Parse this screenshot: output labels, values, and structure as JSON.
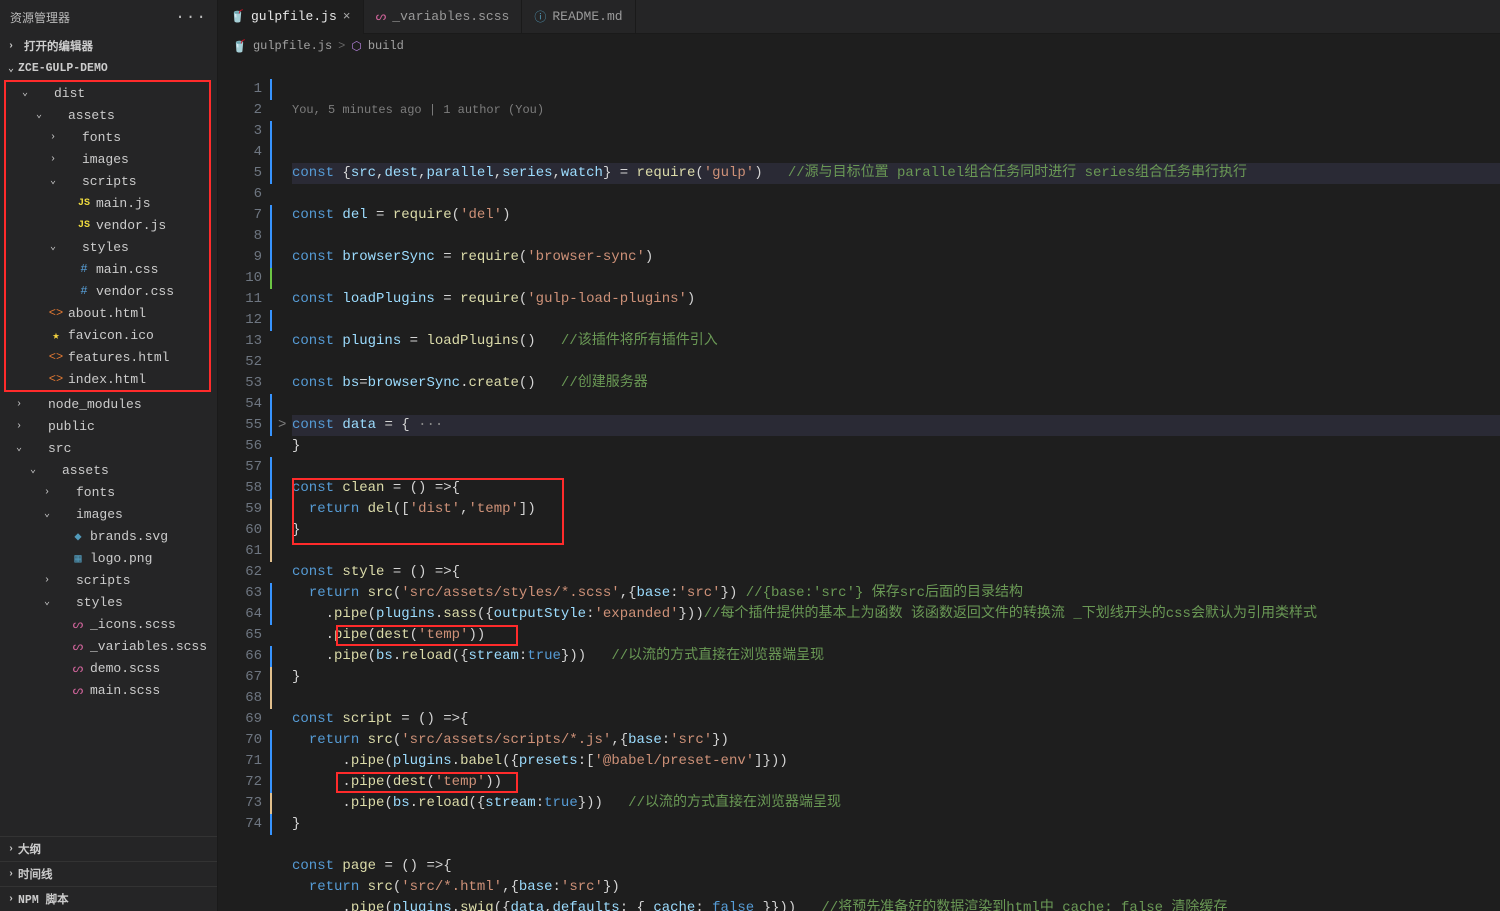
{
  "sidebar": {
    "title": "资源管理器",
    "sections": {
      "open_editors": "打开的编辑器",
      "project": "ZCE-GULP-DEMO",
      "outline": "大纲",
      "timeline": "时间线",
      "npm": "NPM 脚本"
    },
    "tree_top": [
      {
        "d": 1,
        "chev": "v",
        "ico": "",
        "cls": "",
        "name": "dist"
      },
      {
        "d": 2,
        "chev": "v",
        "ico": "",
        "cls": "",
        "name": "assets"
      },
      {
        "d": 3,
        "chev": ">",
        "ico": "",
        "cls": "",
        "name": "fonts"
      },
      {
        "d": 3,
        "chev": ">",
        "ico": "",
        "cls": "",
        "name": "images"
      },
      {
        "d": 3,
        "chev": "v",
        "ico": "",
        "cls": "",
        "name": "scripts"
      },
      {
        "d": 4,
        "chev": "",
        "ico": "JS",
        "cls": "js",
        "name": "main.js"
      },
      {
        "d": 4,
        "chev": "",
        "ico": "JS",
        "cls": "js",
        "name": "vendor.js"
      },
      {
        "d": 3,
        "chev": "v",
        "ico": "",
        "cls": "",
        "name": "styles"
      },
      {
        "d": 4,
        "chev": "",
        "ico": "#",
        "cls": "css",
        "name": "main.css"
      },
      {
        "d": 4,
        "chev": "",
        "ico": "#",
        "cls": "css",
        "name": "vendor.css"
      },
      {
        "d": 2,
        "chev": "",
        "ico": "<>",
        "cls": "html",
        "name": "about.html"
      },
      {
        "d": 2,
        "chev": "",
        "ico": "★",
        "cls": "star",
        "name": "favicon.ico"
      },
      {
        "d": 2,
        "chev": "",
        "ico": "<>",
        "cls": "html",
        "name": "features.html"
      },
      {
        "d": 2,
        "chev": "",
        "ico": "<>",
        "cls": "html",
        "name": "index.html"
      }
    ],
    "tree_bottom": [
      {
        "d": 1,
        "chev": ">",
        "ico": "",
        "cls": "",
        "name": "node_modules"
      },
      {
        "d": 1,
        "chev": ">",
        "ico": "",
        "cls": "",
        "name": "public"
      },
      {
        "d": 1,
        "chev": "v",
        "ico": "",
        "cls": "",
        "name": "src"
      },
      {
        "d": 2,
        "chev": "v",
        "ico": "",
        "cls": "",
        "name": "assets"
      },
      {
        "d": 3,
        "chev": ">",
        "ico": "",
        "cls": "",
        "name": "fonts"
      },
      {
        "d": 3,
        "chev": "v",
        "ico": "",
        "cls": "",
        "name": "images"
      },
      {
        "d": 4,
        "chev": "",
        "ico": "◆",
        "cls": "img",
        "name": "brands.svg"
      },
      {
        "d": 4,
        "chev": "",
        "ico": "▦",
        "cls": "img",
        "name": "logo.png"
      },
      {
        "d": 3,
        "chev": ">",
        "ico": "",
        "cls": "",
        "name": "scripts"
      },
      {
        "d": 3,
        "chev": "v",
        "ico": "",
        "cls": "",
        "name": "styles"
      },
      {
        "d": 4,
        "chev": "",
        "ico": "ᔕ",
        "cls": "scss",
        "name": "_icons.scss"
      },
      {
        "d": 4,
        "chev": "",
        "ico": "ᔕ",
        "cls": "scss",
        "name": "_variables.scss"
      },
      {
        "d": 4,
        "chev": "",
        "ico": "ᔕ",
        "cls": "scss",
        "name": "demo.scss"
      },
      {
        "d": 4,
        "chev": "",
        "ico": "ᔕ",
        "cls": "scss",
        "name": "main.scss"
      }
    ]
  },
  "tabs": [
    {
      "ico": "🥤",
      "icoColor": "#e06c75",
      "label": "gulpfile.js",
      "active": true,
      "close": "×"
    },
    {
      "ico": "ᔕ",
      "icoColor": "#cf649a",
      "label": "_variables.scss",
      "active": false,
      "close": ""
    },
    {
      "ico": "ⓘ",
      "icoColor": "#519aba",
      "label": "README.md",
      "active": false,
      "close": ""
    }
  ],
  "breadcrumb": {
    "file_ico": "🥤",
    "file": "gulpfile.js",
    "sep": ">",
    "sym_ico": "⬡",
    "sym": "build"
  },
  "codelens": "You, 5 minutes ago | 1 author (You)",
  "line_numbers": [
    1,
    2,
    3,
    4,
    5,
    6,
    7,
    8,
    9,
    10,
    11,
    12,
    13,
    52,
    53,
    54,
    55,
    56,
    57,
    58,
    59,
    60,
    61,
    62,
    63,
    64,
    65,
    66,
    67,
    68,
    69,
    70,
    71,
    72,
    73,
    74
  ],
  "gutter_bars": {
    "blue": [
      0,
      2,
      3,
      4,
      6,
      7,
      8,
      11,
      15,
      16,
      18,
      19,
      24,
      25,
      27,
      31,
      32,
      33,
      35
    ],
    "green": [
      9
    ],
    "yellow": [
      20,
      21,
      22,
      28,
      29,
      34
    ]
  },
  "code_lines": [
    {
      "k": "hl",
      "h": "<span class='kw'>const</span> <span class='pn'>{</span><span class='id'>src</span><span class='pn'>,</span><span class='id'>dest</span><span class='pn'>,</span><span class='id'>parallel</span><span class='pn'>,</span><span class='id'>series</span><span class='pn'>,</span><span class='id'>watch</span><span class='pn'>} = </span><span class='fn'>require</span><span class='pn'>(</span><span class='str'>'gulp'</span><span class='pn'>)</span>   <span class='cm'>//源与目标位置 parallel组合任务同时进行 series组合任务串行执行</span>"
    },
    {
      "h": ""
    },
    {
      "h": "<span class='kw'>const</span> <span class='id'>del</span> <span class='pn'>=</span> <span class='fn'>require</span><span class='pn'>(</span><span class='str'>'del'</span><span class='pn'>)</span>"
    },
    {
      "h": ""
    },
    {
      "h": "<span class='kw'>const</span> <span class='id'>browserSync</span> <span class='pn'>=</span> <span class='fn'>require</span><span class='pn'>(</span><span class='str'>'browser-sync'</span><span class='pn'>)</span>"
    },
    {
      "h": ""
    },
    {
      "h": "<span class='kw'>const</span> <span class='id'>loadPlugins</span> <span class='pn'>=</span> <span class='fn'>require</span><span class='pn'>(</span><span class='str'>'gulp-load-plugins'</span><span class='pn'>)</span>"
    },
    {
      "h": ""
    },
    {
      "h": "<span class='kw'>const</span> <span class='id'>plugins</span> <span class='pn'>=</span> <span class='fn'>loadPlugins</span><span class='pn'>()</span>   <span class='cm'>//该插件将所有插件引入</span>"
    },
    {
      "h": ""
    },
    {
      "h": "<span class='kw'>const</span> <span class='id'>bs</span><span class='pn'>=</span><span class='id'>browserSync</span><span class='pn'>.</span><span class='fn'>create</span><span class='pn'>()</span>   <span class='cm'>//创建服务器</span>"
    },
    {
      "h": ""
    },
    {
      "k": "hl",
      "fold": ">",
      "h": "<span class='kw'>const</span> <span class='id'>data</span> <span class='pn'>= {</span> <span class='pn' style='color:#888'>···</span>"
    },
    {
      "h": "<span class='pn'>}</span>"
    },
    {
      "h": ""
    },
    {
      "h": "<span class='kw'>const</span> <span class='fn'>clean</span> <span class='pn'>= () =&gt;{</span>"
    },
    {
      "h": "  <span class='kw'>return</span> <span class='fn'>del</span><span class='pn'>([</span><span class='str'>'dist'</span><span class='pn'>,</span><span class='str'>'temp'</span><span class='pn'>])</span>"
    },
    {
      "h": "<span class='pn'>}</span>"
    },
    {
      "h": ""
    },
    {
      "h": "<span class='kw'>const</span> <span class='fn'>style</span> <span class='pn'>= () =&gt;{</span>"
    },
    {
      "h": "  <span class='kw'>return</span> <span class='fn'>src</span><span class='pn'>(</span><span class='str'>'src/assets/styles/*.scss'</span><span class='pn'>,{</span><span class='id'>base</span><span class='pn'>:</span><span class='str'>'src'</span><span class='pn'>})</span> <span class='cm'>//{base:'src'} 保存src后面的目录结构</span>"
    },
    {
      "h": "    <span class='pn'>.</span><span class='fn'>pipe</span><span class='pn'>(</span><span class='id'>plugins</span><span class='pn'>.</span><span class='fn'>sass</span><span class='pn'>({</span><span class='id'>outputStyle</span><span class='pn'>:</span><span class='str'>'expanded'</span><span class='pn'>}))</span><span class='cm'>//每个插件提供的基本上为函数 该函数返回文件的转换流 _下划线开头的css会默认为引用类样式</span>"
    },
    {
      "h": "    <span class='pn'>.</span><span class='fn'>pipe</span><span class='pn'>(</span><span class='fn'>dest</span><span class='pn'>(</span><span class='str'>'temp'</span><span class='pn'>))</span>"
    },
    {
      "h": "    <span class='pn'>.</span><span class='fn'>pipe</span><span class='pn'>(</span><span class='id'>bs</span><span class='pn'>.</span><span class='fn'>reload</span><span class='pn'>({</span><span class='id'>stream</span><span class='pn'>:</span><span class='bool'>true</span><span class='pn'>}))</span>   <span class='cm'>//以流的方式直接在浏览器端呈现</span>"
    },
    {
      "h": "<span class='pn'>}</span>"
    },
    {
      "h": ""
    },
    {
      "h": "<span class='kw'>const</span> <span class='fn'>script</span> <span class='pn'>= () =&gt;{</span>"
    },
    {
      "h": "  <span class='kw'>return</span> <span class='fn'>src</span><span class='pn'>(</span><span class='str'>'src/assets/scripts/*.js'</span><span class='pn'>,{</span><span class='id'>base</span><span class='pn'>:</span><span class='str'>'src'</span><span class='pn'>})</span>"
    },
    {
      "h": "      <span class='pn'>.</span><span class='fn'>pipe</span><span class='pn'>(</span><span class='id'>plugins</span><span class='pn'>.</span><span class='fn'>babel</span><span class='pn'>({</span><span class='id'>presets</span><span class='pn'>:[</span><span class='str'>'@babel/preset-env'</span><span class='pn'>]}))</span>"
    },
    {
      "h": "      <span class='pn'>.</span><span class='fn'>pipe</span><span class='pn'>(</span><span class='fn'>dest</span><span class='pn'>(</span><span class='str'>'temp'</span><span class='pn'>))</span>"
    },
    {
      "h": "      <span class='pn'>.</span><span class='fn'>pipe</span><span class='pn'>(</span><span class='id'>bs</span><span class='pn'>.</span><span class='fn'>reload</span><span class='pn'>({</span><span class='id'>stream</span><span class='pn'>:</span><span class='bool'>true</span><span class='pn'>}))</span>   <span class='cm'>//以流的方式直接在浏览器端呈现</span>"
    },
    {
      "h": "<span class='pn'>}</span>"
    },
    {
      "h": ""
    },
    {
      "h": "<span class='kw'>const</span> <span class='fn'>page</span> <span class='pn'>= () =&gt;{</span>"
    },
    {
      "h": "  <span class='kw'>return</span> <span class='fn'>src</span><span class='pn'>(</span><span class='str'>'src/*.html'</span><span class='pn'>,{</span><span class='id'>base</span><span class='pn'>:</span><span class='str'>'src'</span><span class='pn'>})</span>"
    },
    {
      "h": "      <span class='pn'>.</span><span class='fn'>pipe</span><span class='pn'>(</span><span class='id'>plugins</span><span class='pn'>.</span><span class='fn'>swig</span><span class='pn'>({</span><span class='id'>data</span><span class='pn'>,</span><span class='id'>defaults</span><span class='pn'>: { </span><span class='id'>cache</span><span class='pn'>: </span><span class='bool'>false</span><span class='pn'> }}))</span>   <span class='cm'>//将预先准备好的数据渲染到html中 cache: false 清除缓存</span>"
    }
  ]
}
